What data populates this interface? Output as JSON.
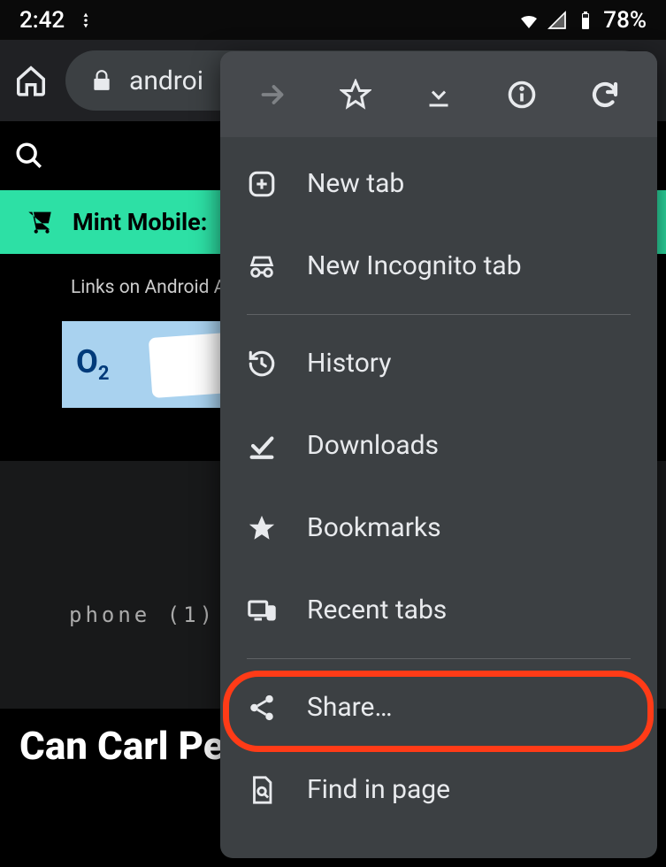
{
  "statusbar": {
    "time": "2:42",
    "battery": "78%"
  },
  "urlbar": {
    "url_display": "androi"
  },
  "page": {
    "promo_text": "Mint Mobile:",
    "links_text": "Links on Android A",
    "ad_brand_prefix": "O",
    "ad_brand_sub": "2",
    "dotmatrix": "phone (1)",
    "headline": "Can Carl Pei"
  },
  "menu": {
    "items": {
      "new_tab": "New tab",
      "new_incognito": "New Incognito tab",
      "history": "History",
      "downloads": "Downloads",
      "bookmarks": "Bookmarks",
      "recent_tabs": "Recent tabs",
      "share": "Share…",
      "find_in_page": "Find in page"
    }
  }
}
